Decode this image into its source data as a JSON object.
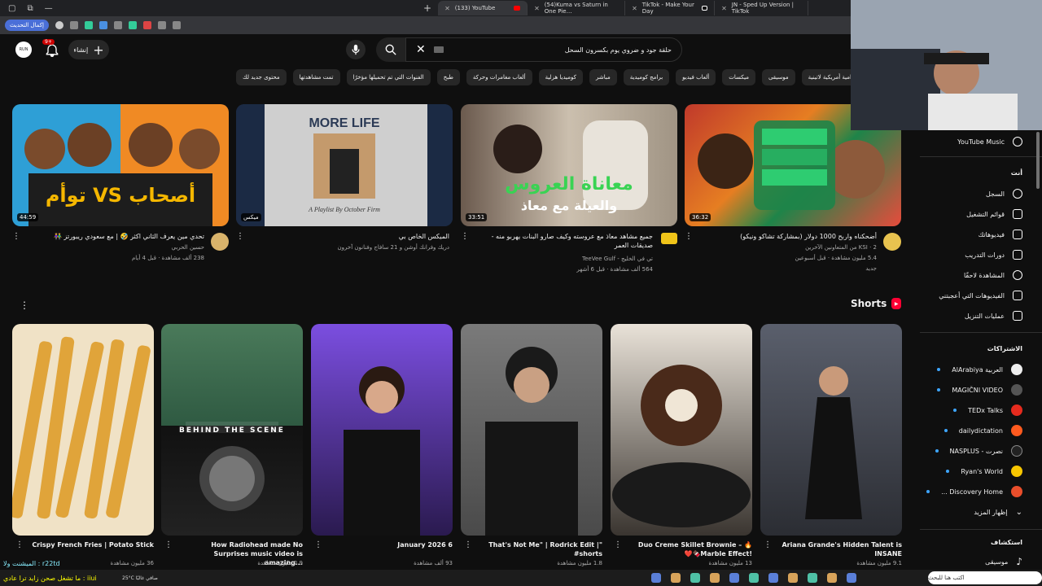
{
  "browser": {
    "window_buttons": [
      "▢",
      "⧉",
      "—"
    ],
    "tabs": [
      {
        "label": "(133) YouTube",
        "active": true
      },
      {
        "label": "(54)Kuma vs Saturn in One Pie…"
      },
      {
        "label": "TikTok - Make Your Day"
      },
      {
        "label": "JN - Sped Up Version | TikTok"
      }
    ],
    "new_tab": "+",
    "update_button": "إكمال التحديث"
  },
  "header": {
    "avatar_text": "RUN",
    "notifications_count": "9+",
    "create_label": "إنشاء",
    "search_query": "حلقة جود و ضروي يوم بكسرون السحل"
  },
  "chips": [
    "مسلسلات درامية أمريكية لاتينية",
    "موسيقى",
    "ميكسات",
    "ألعاب فيديو",
    "برامج كوميدية",
    "مباشر",
    "كوميديا هزلية",
    "ألعاب مغامرات وحركة",
    "طبخ",
    "الفنوات التي تم تحميلها مؤخرًا",
    "تمت مشاهدتها",
    "محتوى جديد لك"
  ],
  "videos": [
    {
      "title": "أضحكناه واربح 1000 دولار (بمشاركة تشاكو ونيكو)",
      "channel": "KSI · 2 من المتعاونين الآخرين",
      "meta": "5.4 مليون مشاهدة · قبل أسبوعين",
      "extra": "جديد",
      "duration": "36:32",
      "accent": "#0a6e2e",
      "chcolor": "#e8c34f"
    },
    {
      "title": "جميع مشاهد معاذ مع عروسته وكيف صارو البنات يهربو منه - صديقات العمر",
      "channel": "تي في الخليج - TeeVee Gulf",
      "meta": "564 ألف مشاهدة · قبل 6 أشهر",
      "extra": "",
      "duration": "33:51",
      "accent": "#cfcfcf",
      "chcolor": "#f0c419"
    },
    {
      "title": "الميكس الخاص بي",
      "channel": "دريك وفرانك أوشن و 21 سافاج وفنانون آخرون",
      "meta": "",
      "extra": "",
      "duration": "ميكس",
      "accent": "#2b3a55",
      "chcolor": ""
    },
    {
      "title": "تحدي مين يعرف الثاني اكثر 🤣 | مع سعودي ريبورتز 👫",
      "channel": "حسين الحربي",
      "meta": "238 ألف مشاهدة · قبل 4 أيام",
      "extra": "",
      "duration": "44:59",
      "accent": "#e2671f",
      "chcolor": "#d9b36b"
    }
  ],
  "shorts": {
    "title": "Shorts",
    "items": [
      {
        "title": "Ariana Grande's Hidden Talent is INSANE",
        "views": "9.1 مليون مشاهدة",
        "bg": "#4a4f5c"
      },
      {
        "title": "Duo Creme Skillet Brownie – 🔥❤️🍫Marble Effect!",
        "views": "13 مليون مشاهدة",
        "bg": "#3a3530"
      },
      {
        "title": "That's Not Me\" | Rodrick Edit |\" #shorts",
        "views": "1.8 مليون مشاهدة",
        "bg": "#6a6a6a"
      },
      {
        "title": "January 2026 6",
        "views": "93 ألف مشاهدة",
        "bg": "#4b2a8a"
      },
      {
        "title": "How Radiohead made No Surprises music video is amazing...",
        "views": "2.9 مليون مشاهدة",
        "bg": "#2f5a42"
      },
      {
        "title": "Crispy French Fries | Potato Stick",
        "views": "36 مليون مشاهدة",
        "bg": "#e9b34f"
      }
    ]
  },
  "sidebar": {
    "youtube_music": "YouTube Music",
    "you_header": "أنت",
    "you_items": [
      "السجل",
      "قوائم التشغيل",
      "فيديوهاتك",
      "دورات التدريب",
      "المشاهدة لاحقًا",
      "الفيديوهات التي أعجبتني",
      "عمليات التنزيل"
    ],
    "subs_header": "الاشتراكات",
    "channels": [
      {
        "name": "العربية AlArabiya",
        "color": "#eee"
      },
      {
        "name": "MAGIČNI VIDEO",
        "color": "#555"
      },
      {
        "name": "TEDx Talks",
        "color": "#e62b1e"
      },
      {
        "name": "dailydictation",
        "color": "#ff5a1f"
      },
      {
        "name": "نصرت - NASPLUS",
        "color": "#222"
      },
      {
        "name": "Ryan's World",
        "color": "#f7c600"
      },
      {
        "name": "Discovery Home ...",
        "color": "#e94e2b"
      }
    ],
    "show_more": "إظهار المزيد",
    "explore_header": "استكشاف",
    "explore_first": "موسيقى"
  },
  "bottom": {
    "chat1": "الميشنت ولا : r22td",
    "chat2": "ما تشغل صحن زايد ترا عادي : iiui",
    "weather": "25°C صافي غالبًا",
    "taskbar_search": "اكتب هنا للبحث"
  }
}
